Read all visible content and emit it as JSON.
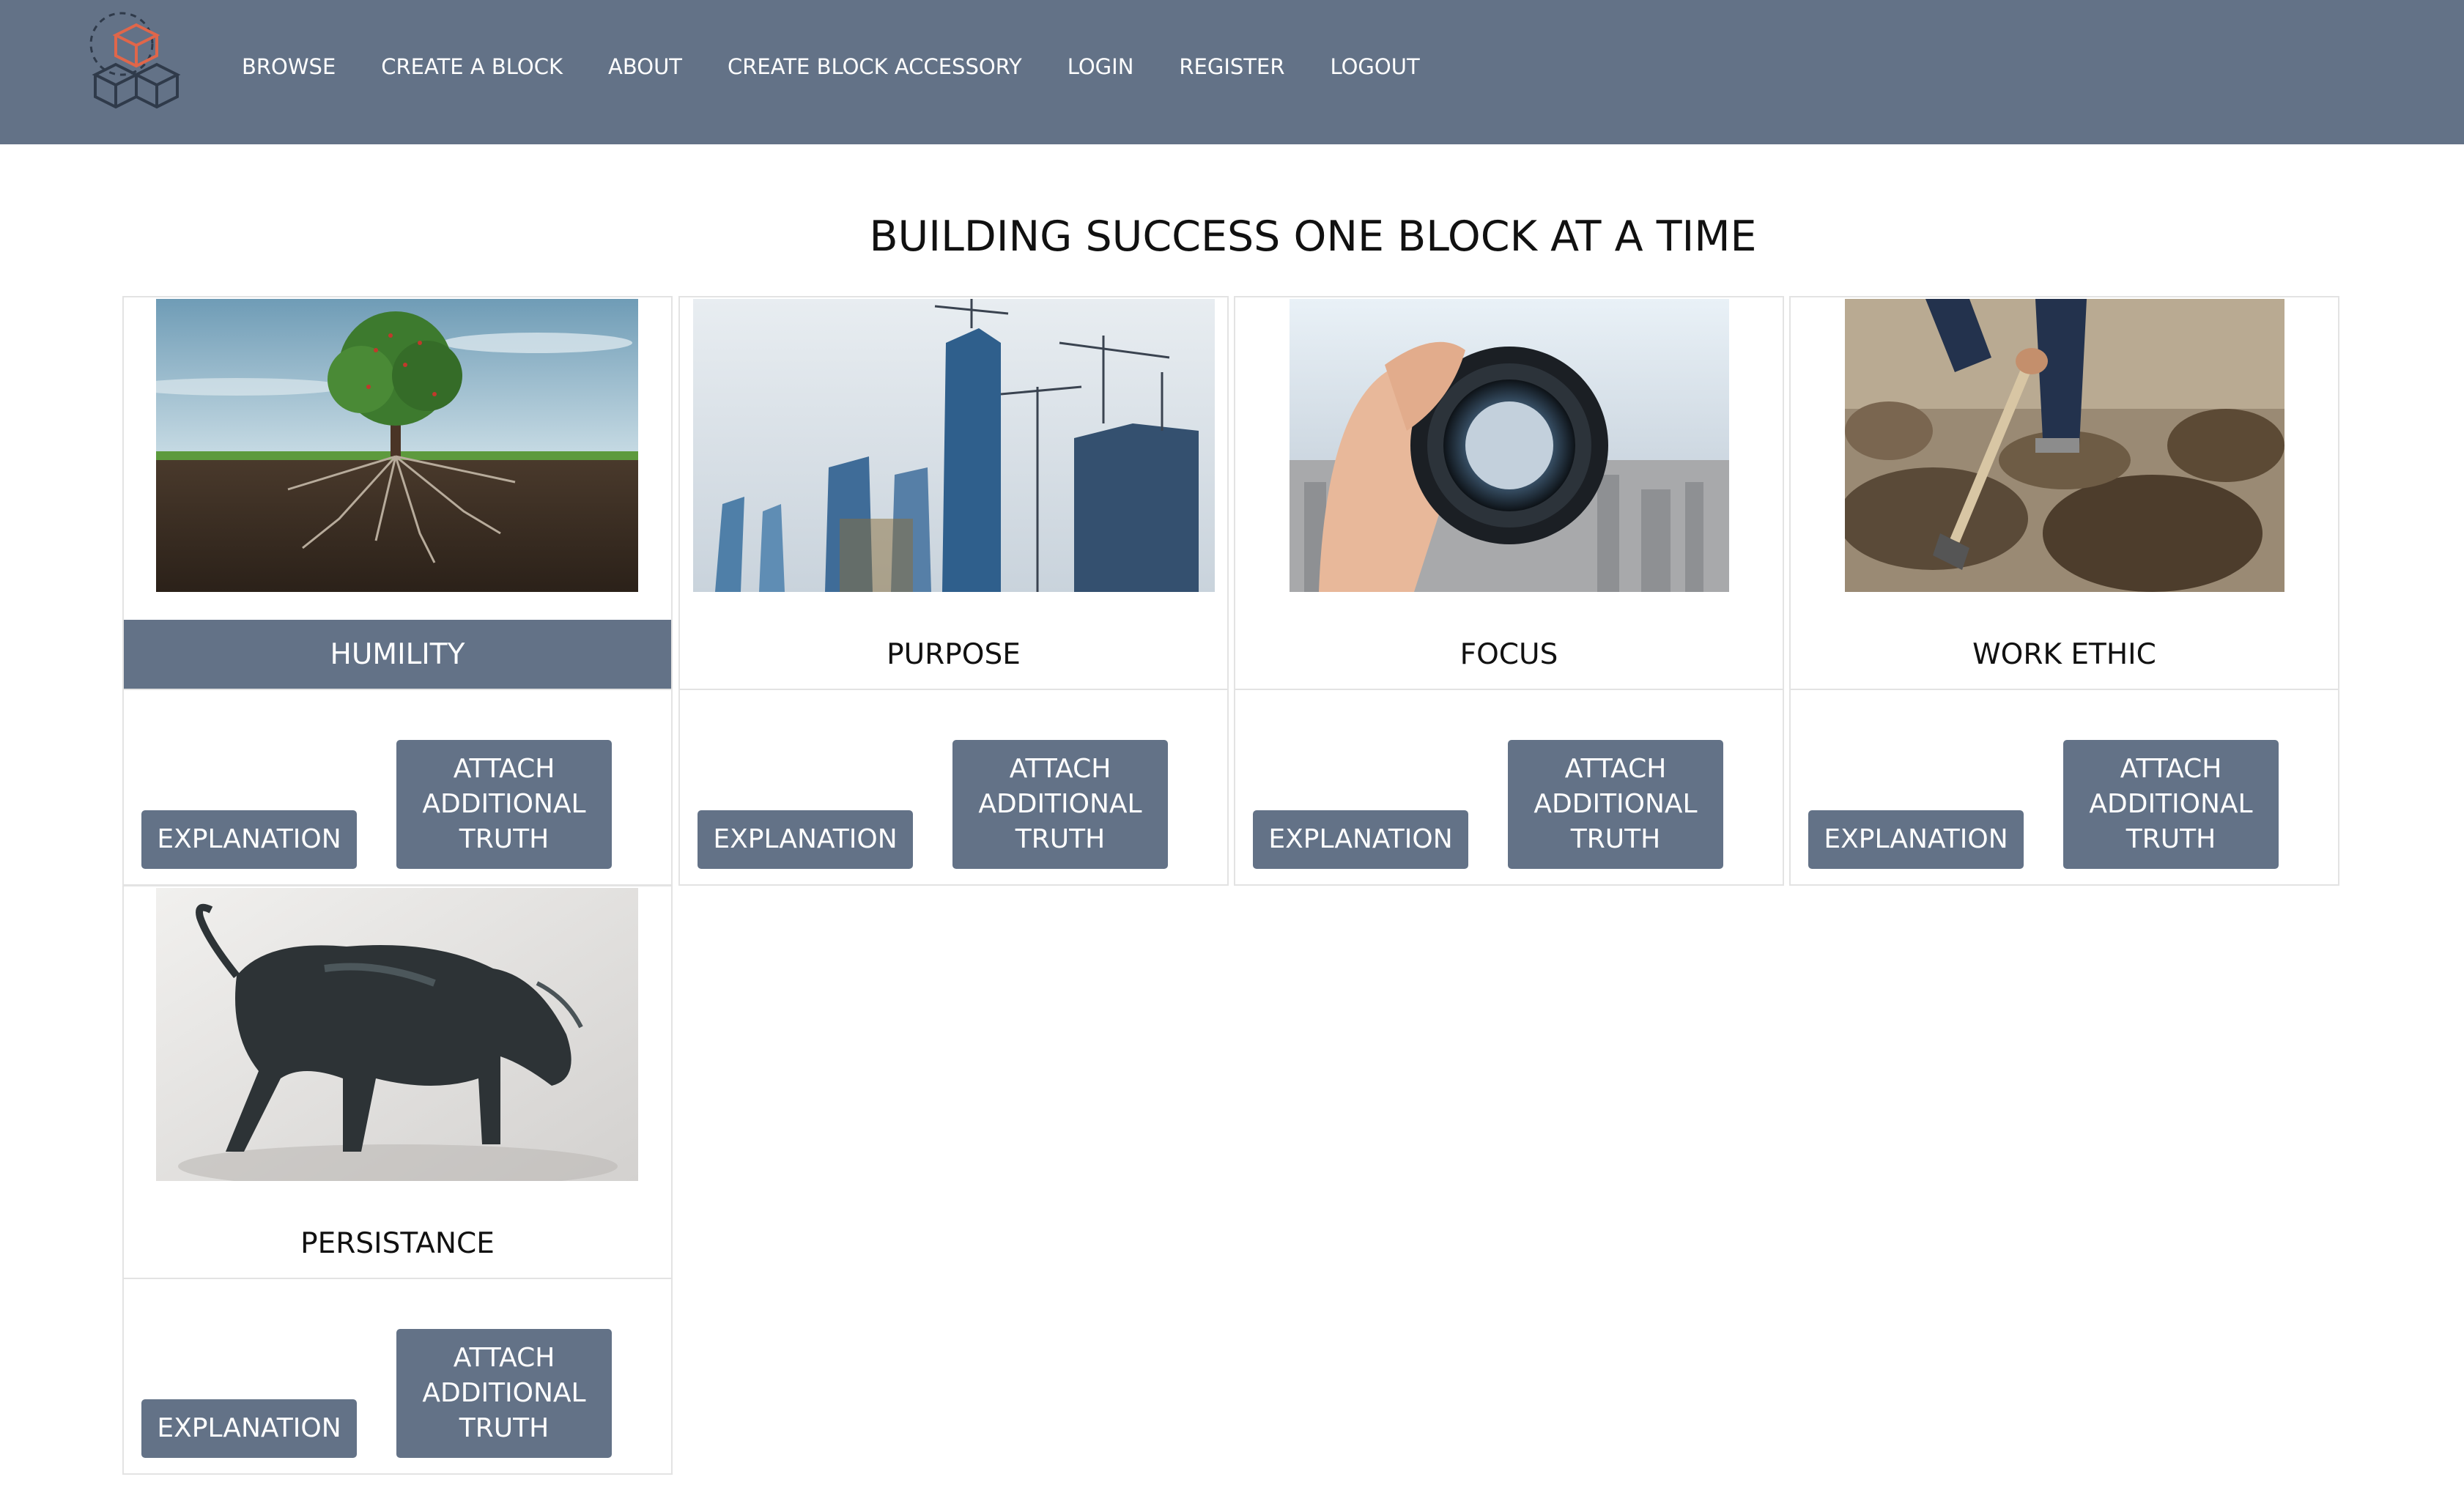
{
  "nav": {
    "logo_icon": "stacked-cubes-logo",
    "links": [
      "BROWSE",
      "CREATE A BLOCK",
      "ABOUT",
      "CREATE BLOCK ACCESSORY",
      "LOGIN",
      "REGISTER",
      "LOGOUT"
    ]
  },
  "page": {
    "title": "BUILDING SUCCESS ONE BLOCK AT A TIME"
  },
  "cards": [
    {
      "label": "HUMILITY",
      "image": "tree-with-roots",
      "explain": "EXPLANATION",
      "attach": "ATTACH ADDITIONAL TRUTH",
      "active": true
    },
    {
      "label": "PURPOSE",
      "image": "skyscraper-construction-cranes",
      "explain": "EXPLANATION",
      "attach": "ATTACH ADDITIONAL TRUTH",
      "active": false
    },
    {
      "label": "FOCUS",
      "image": "camera-lens-city-view",
      "explain": "EXPLANATION",
      "attach": "ATTACH ADDITIONAL TRUTH",
      "active": false
    },
    {
      "label": "WORK ETHIC",
      "image": "man-digging-with-pickaxe",
      "explain": "EXPLANATION",
      "attach": "ATTACH ADDITIONAL TRUTH",
      "active": false
    },
    {
      "label": "PERSISTANCE",
      "image": "bronze-bull-sculpture",
      "explain": "EXPLANATION",
      "attach": "ATTACH ADDITIONAL TRUTH",
      "active": false
    }
  ],
  "colors": {
    "nav_bg": "#637287",
    "button_bg": "#637287",
    "logo_accent": "#e0664a",
    "border": "#e3e3e3"
  }
}
